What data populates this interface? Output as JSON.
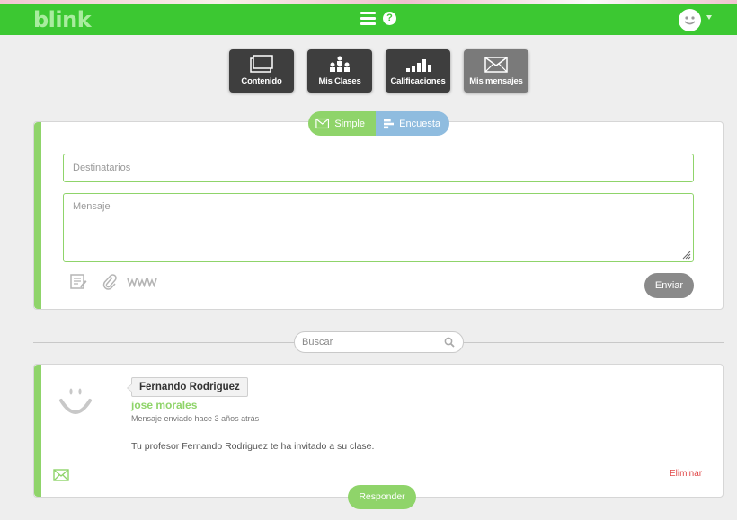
{
  "app": {
    "logo": "blink"
  },
  "nav": {
    "items": [
      {
        "label": "Contenido",
        "icon": "content-icon"
      },
      {
        "label": "Mis Clases",
        "icon": "classes-icon"
      },
      {
        "label": "Calificaciones",
        "icon": "grades-icon"
      },
      {
        "label": "Mis mensajes",
        "icon": "messages-icon",
        "active": true
      }
    ]
  },
  "composer": {
    "modes": {
      "simple": "Simple",
      "survey": "Encuesta"
    },
    "recipients_placeholder": "Destinatarios",
    "message_placeholder": "Mensaje",
    "send_label": "Enviar"
  },
  "search": {
    "placeholder": "Buscar"
  },
  "message": {
    "sender": "Fernando Rodriguez",
    "recipient": "jose morales",
    "sent": "Mensaje enviado hace 3 años atrás",
    "body": "Tu profesor Fernando Rodriguez te ha invitado a su clase.",
    "delete_label": "Eliminar",
    "reply_label": "Responder"
  },
  "colors": {
    "brand_green": "#3cc832",
    "accent_green": "#8fd46a",
    "survey_blue": "#8fbcdf",
    "delete_red": "#e04848"
  }
}
